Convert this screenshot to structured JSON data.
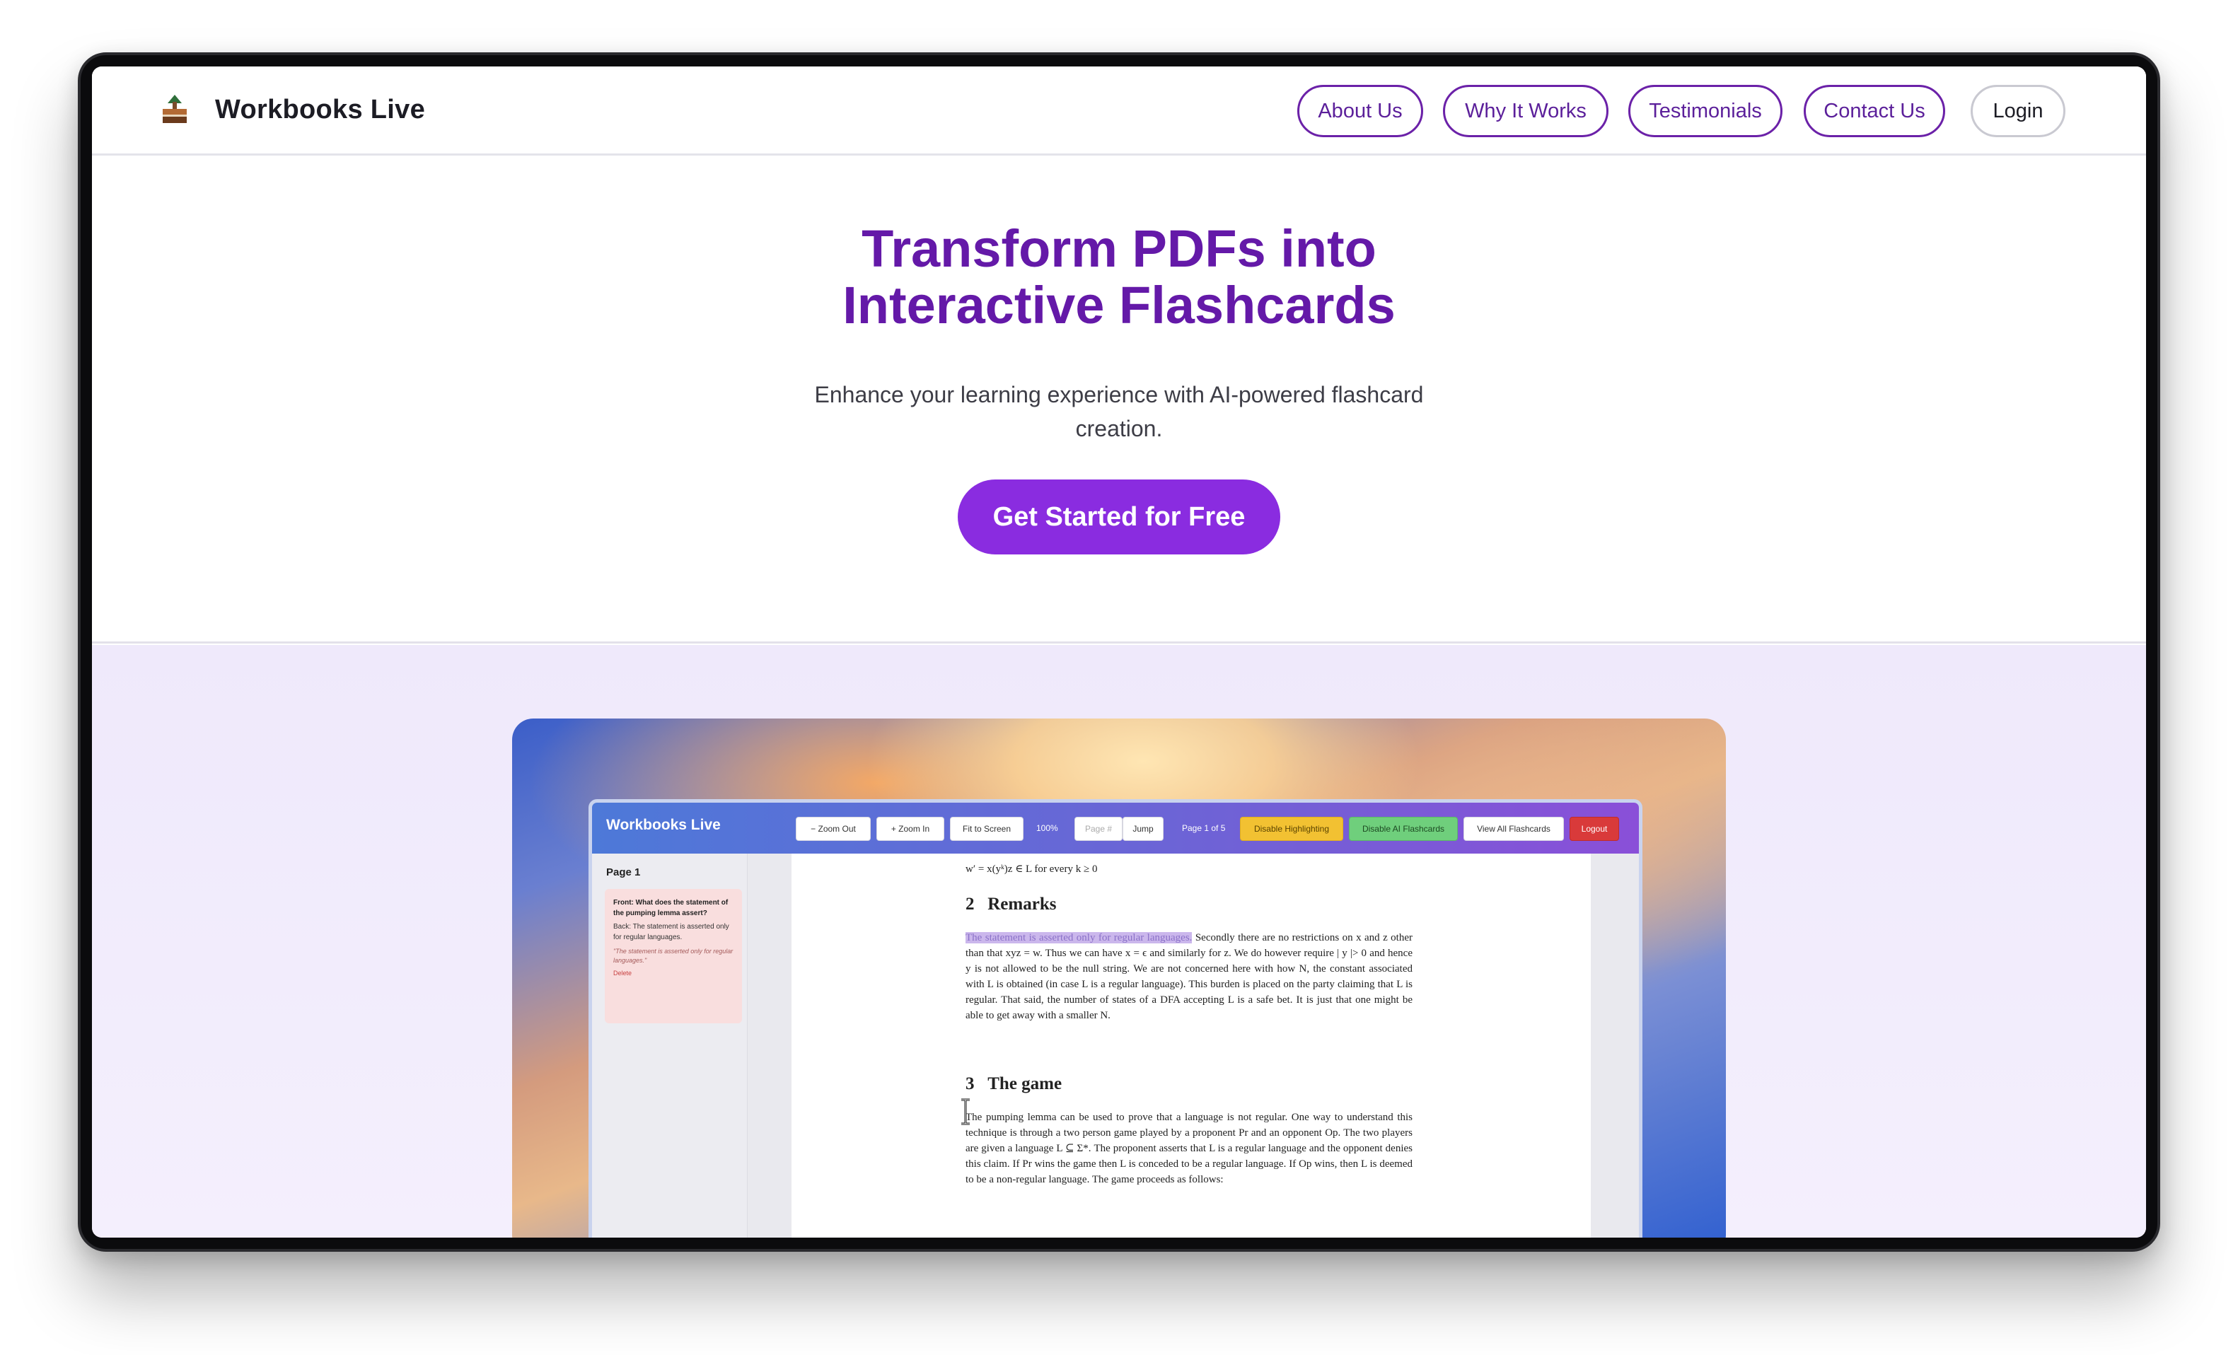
{
  "header": {
    "brand": "Workbooks Live",
    "nav": [
      "About Us",
      "Why It Works",
      "Testimonials",
      "Contact Us"
    ],
    "login": "Login"
  },
  "hero": {
    "title_line1": "Transform PDFs into",
    "title_line2": "Interactive Flashcards",
    "subtitle_line1": "Enhance your learning experience with AI-powered flashcard",
    "subtitle_line2": "creation.",
    "cta": "Get Started for Free"
  },
  "app": {
    "title": "Workbooks Live",
    "toolbar": {
      "zoom_out": "− Zoom Out",
      "zoom_in": "+ Zoom In",
      "fit": "Fit to Screen",
      "zoom_level": "100%",
      "page_placeholder": "Page #",
      "jump": "Jump",
      "page_of": "Page 1 of 5",
      "disable_highlighting": "Disable Highlighting",
      "disable_ai": "Disable AI Flashcards",
      "view_all": "View All Flashcards",
      "logout": "Logout"
    },
    "sidebar": {
      "page_label": "Page 1",
      "card": {
        "front": "Front: What does the statement of the pumping lemma assert?",
        "back": "Back: The statement is asserted only for regular languages.",
        "quote": "\"The statement is asserted only for regular languages.\"",
        "delete": "Delete"
      }
    },
    "document": {
      "top_line": "w′ = x(yᵏ)z ∈ L for every k ≥ 0",
      "section2_num": "2",
      "section2_title": "Remarks",
      "section2_highlight": "The statement is asserted only for regular languages.",
      "section2_text": " Secondly there are no restrictions on x and z other than that xyz = w. Thus we can have x = ϵ and similarly for z. We do however require | y |> 0 and hence y is not allowed to be the null string. We are not concerned here with how N, the constant associated with L is obtained (in case L is a regular language). This burden is placed on the party claiming that L is regular. That said, the number of states of a DFA accepting L is a safe bet. It is just that one might be able to get away with a smaller N.",
      "section3_num": "3",
      "section3_title": "The game",
      "section3_text": "The pumping lemma can be used to prove that a language is not regular. One way to understand this technique is through a two person game played by a proponent Pr and an opponent Op. The two players are given a language L ⊆ Σ*. The proponent asserts that L is a regular language and the opponent denies this claim. If Pr wins the game then L is conceded to be a regular language. If Op wins, then L is deemed to be a non-regular language. The game proceeds as follows:"
    }
  },
  "colors": {
    "accent": "#6419a8",
    "cta": "#8a2ce0",
    "band": "#efe9fb"
  }
}
